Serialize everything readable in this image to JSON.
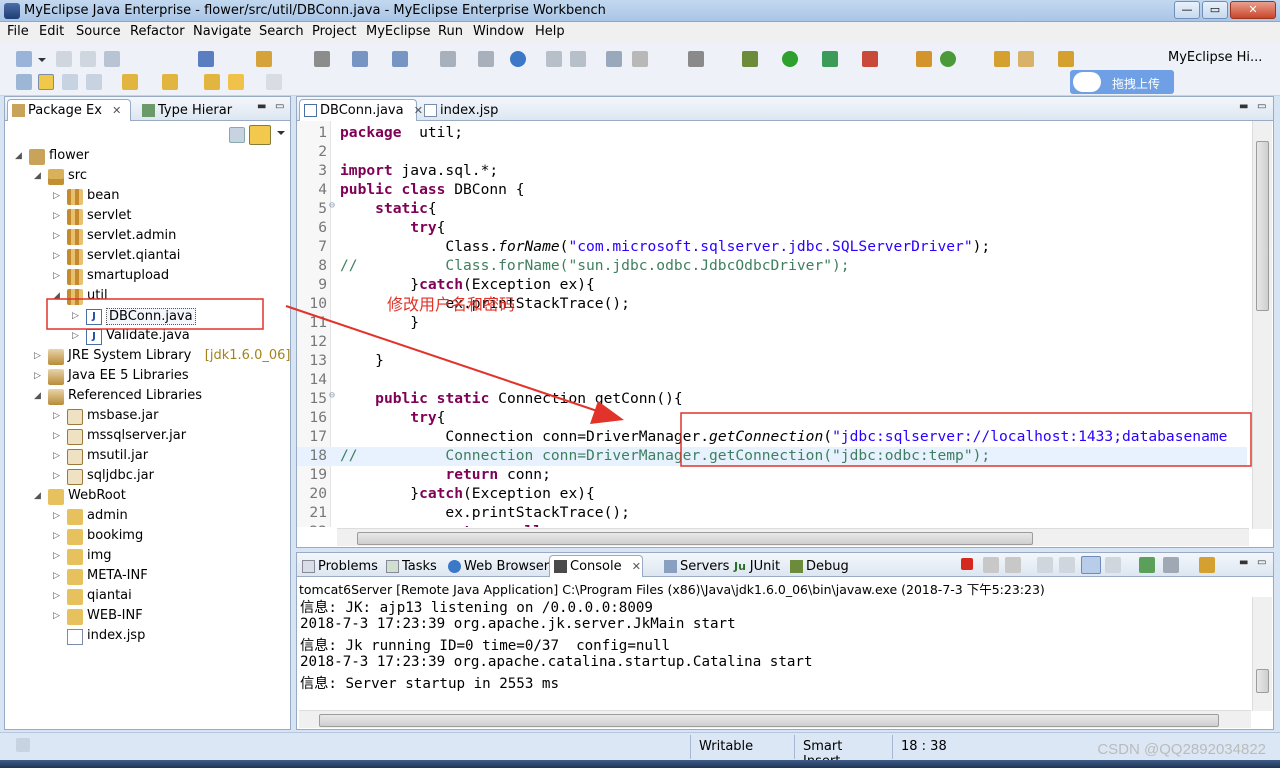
{
  "window": {
    "title": "MyEclipse Java Enterprise - flower/src/util/DBConn.java - MyEclipse Enterprise Workbench",
    "min_label": "—",
    "max_label": "▭",
    "close_label": "✕"
  },
  "menu": [
    "File",
    "Edit",
    "Source",
    "Refactor",
    "Navigate",
    "Search",
    "Project",
    "MyEclipse",
    "Run",
    "Window",
    "Help"
  ],
  "toolbar": {
    "upload_label": "拖拽上传",
    "perspective_label": "MyEclipse Hi..."
  },
  "package_explorer": {
    "tabs": [
      {
        "label": "Package Ex",
        "active": true
      },
      {
        "label": "Type Hierar",
        "active": false
      }
    ],
    "tree": [
      {
        "label": "flower",
        "icon": "project-icon",
        "depth": 0,
        "twisty": "◢"
      },
      {
        "label": "src",
        "icon": "source-folder-icon",
        "depth": 1,
        "twisty": "◢"
      },
      {
        "label": "bean",
        "icon": "package-icon",
        "depth": 2,
        "twisty": "▷"
      },
      {
        "label": "servlet",
        "icon": "package-icon",
        "depth": 2,
        "twisty": "▷"
      },
      {
        "label": "servlet.admin",
        "icon": "package-icon",
        "depth": 2,
        "twisty": "▷"
      },
      {
        "label": "servlet.qiantai",
        "icon": "package-icon",
        "depth": 2,
        "twisty": "▷"
      },
      {
        "label": "smartupload",
        "icon": "package-icon",
        "depth": 2,
        "twisty": "▷"
      },
      {
        "label": "util",
        "icon": "package-icon",
        "depth": 2,
        "twisty": "◢"
      },
      {
        "label": "DBConn.java",
        "icon": "java-file-icon",
        "depth": 3,
        "twisty": "▷",
        "selected": true
      },
      {
        "label": "Validate.java",
        "icon": "java-file-icon",
        "depth": 3,
        "twisty": "▷"
      },
      {
        "label": "JRE System Library",
        "suffix": "[jdk1.6.0_06]",
        "icon": "library-icon",
        "depth": 1,
        "twisty": "▷"
      },
      {
        "label": "Java EE 5 Libraries",
        "icon": "library-icon",
        "depth": 1,
        "twisty": "▷"
      },
      {
        "label": "Referenced Libraries",
        "icon": "library-icon",
        "depth": 1,
        "twisty": "◢"
      },
      {
        "label": "msbase.jar",
        "icon": "jar-icon",
        "depth": 2,
        "twisty": "▷"
      },
      {
        "label": "mssqlserver.jar",
        "icon": "jar-icon",
        "depth": 2,
        "twisty": "▷"
      },
      {
        "label": "msutil.jar",
        "icon": "jar-icon",
        "depth": 2,
        "twisty": "▷"
      },
      {
        "label": "sqljdbc.jar",
        "icon": "jar-icon",
        "depth": 2,
        "twisty": "▷"
      },
      {
        "label": "WebRoot",
        "icon": "folder-icon",
        "depth": 1,
        "twisty": "◢"
      },
      {
        "label": "admin",
        "icon": "folder-icon",
        "depth": 2,
        "twisty": "▷"
      },
      {
        "label": "bookimg",
        "icon": "folder-icon",
        "depth": 2,
        "twisty": "▷"
      },
      {
        "label": "img",
        "icon": "folder-icon",
        "depth": 2,
        "twisty": "▷"
      },
      {
        "label": "META-INF",
        "icon": "folder-icon",
        "depth": 2,
        "twisty": "▷"
      },
      {
        "label": "qiantai",
        "icon": "folder-icon",
        "depth": 2,
        "twisty": "▷"
      },
      {
        "label": "WEB-INF",
        "icon": "folder-icon",
        "depth": 2,
        "twisty": "▷"
      },
      {
        "label": "index.jsp",
        "icon": "jsp-file-icon",
        "depth": 2,
        "twisty": ""
      }
    ]
  },
  "editor": {
    "tabs": [
      {
        "label": "DBConn.java",
        "active": true
      },
      {
        "label": "index.jsp",
        "active": false
      }
    ],
    "annotation": "修改用户名和密码",
    "lines": [
      {
        "n": "1",
        "tokens": [
          [
            "kw",
            "package"
          ],
          [
            "",
            "  util;"
          ]
        ]
      },
      {
        "n": "2",
        "tokens": []
      },
      {
        "n": "3",
        "tokens": [
          [
            "kw",
            "import"
          ],
          [
            "",
            " java.sql.*;"
          ]
        ]
      },
      {
        "n": "4",
        "tokens": [
          [
            "kw",
            "public class"
          ],
          [
            "",
            " DBConn {"
          ]
        ]
      },
      {
        "n": "5",
        "fold": true,
        "tokens": [
          [
            "",
            "    "
          ],
          [
            "kw",
            "static"
          ],
          [
            "",
            "{"
          ]
        ]
      },
      {
        "n": "6",
        "tokens": [
          [
            "",
            "        "
          ],
          [
            "kw",
            "try"
          ],
          [
            "",
            "{"
          ]
        ]
      },
      {
        "n": "7",
        "tokens": [
          [
            "",
            "            Class."
          ],
          [
            "it",
            "forName"
          ],
          [
            "",
            "("
          ],
          [
            "str",
            "\"com.microsoft.sqlserver.jdbc.SQLServerDriver\""
          ],
          [
            "",
            ");"
          ]
        ]
      },
      {
        "n": "8",
        "tokens": [
          [
            "cmt",
            "//          Class.forName(\"sun.jdbc.odbc.JdbcOdbcDriver\");"
          ]
        ]
      },
      {
        "n": "9",
        "tokens": [
          [
            "",
            "        }"
          ],
          [
            "kw",
            "catch"
          ],
          [
            "",
            "(Exception ex){"
          ]
        ]
      },
      {
        "n": "10",
        "tokens": [
          [
            "",
            "            ex.printStackTrace();"
          ]
        ]
      },
      {
        "n": "11",
        "tokens": [
          [
            "",
            "        }"
          ]
        ]
      },
      {
        "n": "12",
        "tokens": []
      },
      {
        "n": "13",
        "tokens": [
          [
            "",
            "    }"
          ]
        ]
      },
      {
        "n": "14",
        "tokens": []
      },
      {
        "n": "15",
        "fold": true,
        "tokens": [
          [
            "",
            "    "
          ],
          [
            "kw",
            "public static"
          ],
          [
            "",
            " Connection getConn(){"
          ]
        ]
      },
      {
        "n": "16",
        "tokens": [
          [
            "",
            "        "
          ],
          [
            "kw",
            "try"
          ],
          [
            "",
            "{"
          ]
        ]
      },
      {
        "n": "17",
        "tokens": [
          [
            "",
            "            Connection conn=DriverManager."
          ],
          [
            "it",
            "getConnection"
          ],
          [
            "",
            "("
          ],
          [
            "str",
            "\"jdbc:sqlserver://localhost:1433;databasename"
          ]
        ]
      },
      {
        "n": "18",
        "highlight": true,
        "tokens": [
          [
            "cmt",
            "//          Connection conn=DriverManager.getConnection(\"jdbc:odbc:temp\");"
          ]
        ]
      },
      {
        "n": "19",
        "tokens": [
          [
            "",
            "            "
          ],
          [
            "kw",
            "return"
          ],
          [
            "",
            " conn;"
          ]
        ]
      },
      {
        "n": "20",
        "tokens": [
          [
            "",
            "        }"
          ],
          [
            "kw",
            "catch"
          ],
          [
            "",
            "(Exception ex){"
          ]
        ]
      },
      {
        "n": "21",
        "tokens": [
          [
            "",
            "            ex.printStackTrace();"
          ]
        ]
      },
      {
        "n": "22",
        "tokens": [
          [
            "",
            "            "
          ],
          [
            "kw",
            "return null"
          ],
          [
            "",
            ";"
          ]
        ]
      }
    ]
  },
  "console": {
    "tabs": [
      {
        "label": "Problems",
        "active": false
      },
      {
        "label": "Tasks",
        "active": false
      },
      {
        "label": "Web Browser",
        "active": false
      },
      {
        "label": "Console",
        "active": true
      },
      {
        "label": "Servers",
        "active": false
      },
      {
        "label": "JUnit",
        "active": false
      },
      {
        "label": "Debug",
        "active": false
      }
    ],
    "header": "tomcat6Server [Remote Java Application] C:\\Program Files (x86)\\Java\\jdk1.6.0_06\\bin\\javaw.exe (2018-7-3 下午5:23:23)",
    "lines": [
      "信息: JK: ajp13 listening on /0.0.0.0:8009",
      "2018-7-3 17:23:39 org.apache.jk.server.JkMain start",
      "信息: Jk running ID=0 time=0/37  config=null",
      "2018-7-3 17:23:39 org.apache.catalina.startup.Catalina start",
      "信息: Server startup in 2553 ms"
    ]
  },
  "status": {
    "writable": "Writable",
    "insert_mode": "Smart Insert",
    "position": "18 : 38",
    "watermark": "CSDN @QQ2892034822"
  },
  "colors": {
    "keyword": "#7f0055",
    "string": "#2a00ff",
    "comment": "#3f7f5f",
    "annotation_red": "#e2332a"
  }
}
